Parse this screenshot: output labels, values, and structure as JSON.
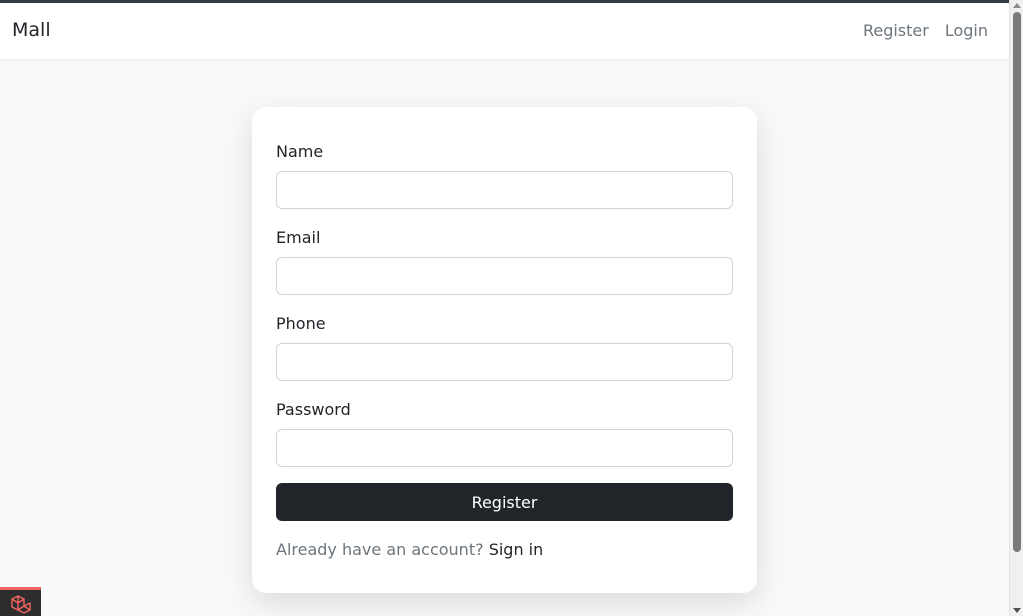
{
  "navbar": {
    "brand": "Mall",
    "links": [
      {
        "label": "Register"
      },
      {
        "label": "Login"
      }
    ]
  },
  "form": {
    "fields": [
      {
        "label": "Name",
        "value": ""
      },
      {
        "label": "Email",
        "value": ""
      },
      {
        "label": "Phone",
        "value": ""
      },
      {
        "label": "Password",
        "value": ""
      }
    ],
    "submit_label": "Register",
    "signin_prompt": "Already have an account?",
    "signin_link": "Sign in"
  },
  "colors": {
    "button": "#212529",
    "muted_text": "#6c757d",
    "debugbar_accent": "#f4645f"
  },
  "icons": {
    "debugbar": "laravel-logo-icon"
  }
}
